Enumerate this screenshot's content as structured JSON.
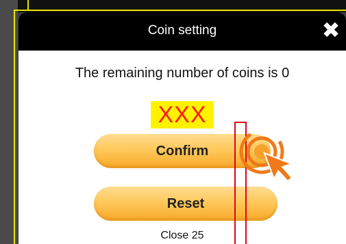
{
  "dialog": {
    "title": "Coin setting",
    "remaining_text": "The remaining number of coins is 0",
    "coin_value": "XXX",
    "confirm_label": "Confirm",
    "reset_label": "Reset",
    "close_countdown": "Close 25"
  },
  "icons": {
    "close": "close-icon",
    "pointer": "tap-pointer-icon"
  },
  "colors": {
    "header_bg": "#000000",
    "button_gradient_top": "#ffdd90",
    "button_gradient_bottom": "#f7a928",
    "highlight_bg": "#fff200",
    "highlight_text": "#ff1a1a",
    "annotation_red": "#e0001b",
    "pointer_orange": "#f07a1a"
  }
}
